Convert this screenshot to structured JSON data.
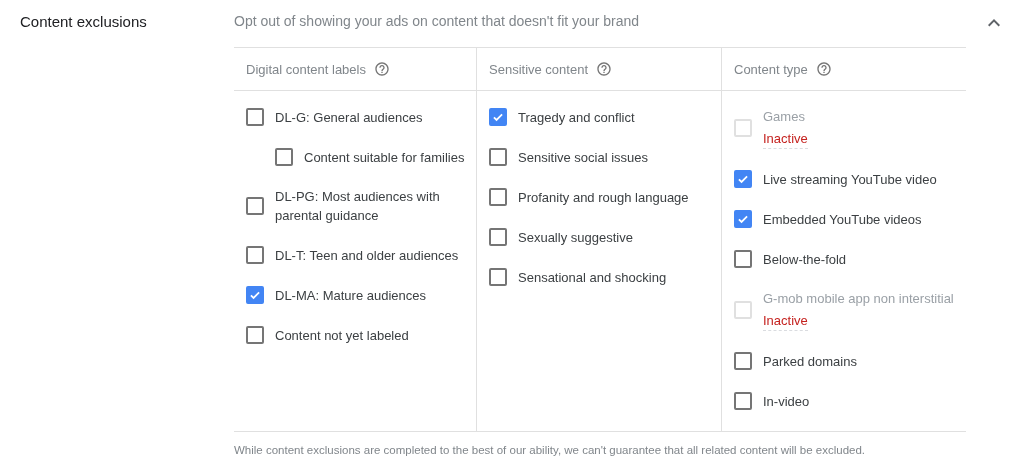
{
  "section": {
    "title": "Content exclusions",
    "description": "Opt out of showing your ads on content that doesn't fit your brand",
    "expanded": true
  },
  "columns": [
    {
      "heading": "Digital content labels",
      "items": [
        {
          "label": "DL-G: General audiences",
          "checked": false,
          "disabled": false,
          "children": [
            {
              "label": "Content suitable for families",
              "checked": false,
              "disabled": false
            }
          ]
        },
        {
          "label": "DL-PG: Most audiences with parental guidance",
          "checked": false,
          "disabled": false
        },
        {
          "label": "DL-T: Teen and older audiences",
          "checked": false,
          "disabled": false
        },
        {
          "label": "DL-MA: Mature audiences",
          "checked": true,
          "disabled": false
        },
        {
          "label": "Content not yet labeled",
          "checked": false,
          "disabled": false
        }
      ]
    },
    {
      "heading": "Sensitive content",
      "items": [
        {
          "label": "Tragedy and conflict",
          "checked": true,
          "disabled": false
        },
        {
          "label": "Sensitive social issues",
          "checked": false,
          "disabled": false
        },
        {
          "label": "Profanity and rough language",
          "checked": false,
          "disabled": false
        },
        {
          "label": "Sexually suggestive",
          "checked": false,
          "disabled": false
        },
        {
          "label": "Sensational and shocking",
          "checked": false,
          "disabled": false
        }
      ]
    },
    {
      "heading": "Content type",
      "items": [
        {
          "label": "Games",
          "checked": false,
          "disabled": true,
          "status": "Inactive"
        },
        {
          "label": "Live streaming YouTube video",
          "checked": true,
          "disabled": false
        },
        {
          "label": "Embedded YouTube videos",
          "checked": true,
          "disabled": false
        },
        {
          "label": "Below-the-fold",
          "checked": false,
          "disabled": false
        },
        {
          "label": "G-mob mobile app non interstitial",
          "checked": false,
          "disabled": true,
          "status": "Inactive"
        },
        {
          "label": "Parked domains",
          "checked": false,
          "disabled": false
        },
        {
          "label": "In-video",
          "checked": false,
          "disabled": false
        }
      ]
    }
  ],
  "footnote": "While content exclusions are completed to the best of our ability, we can't guarantee that all related content will be excluded."
}
